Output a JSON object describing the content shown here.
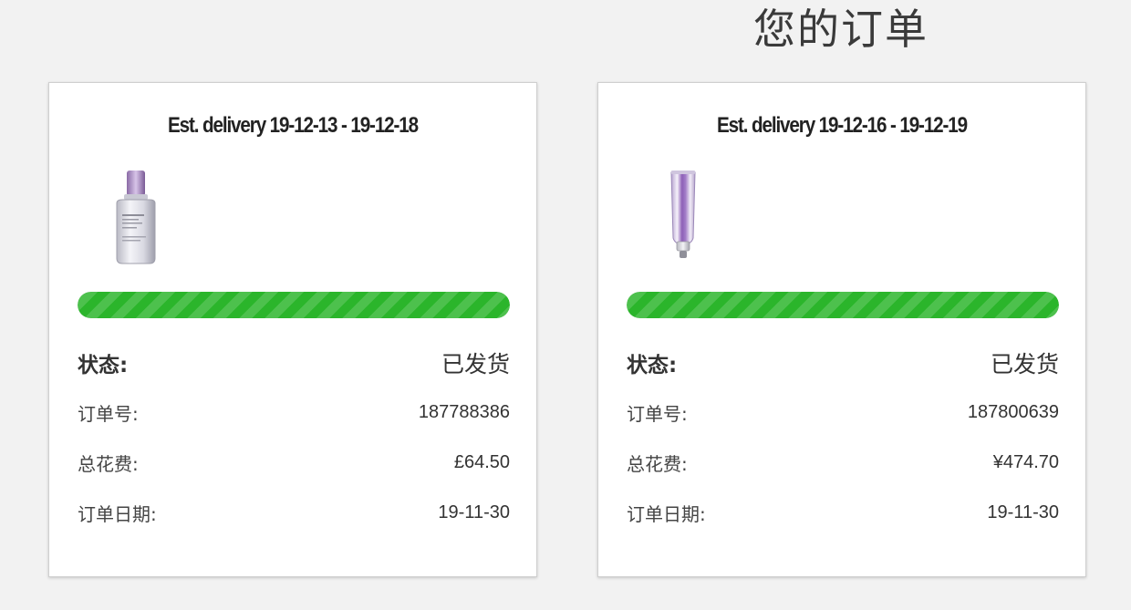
{
  "page": {
    "title": "您的订单"
  },
  "labels": {
    "status": "状态:",
    "order_number": "订单号:",
    "total_cost": "总花费:",
    "order_date": "订单日期:"
  },
  "orders": [
    {
      "delivery": "Est. delivery 19-12-13 - 19-12-18",
      "product_icon": "serum-bottle-icon",
      "progress_percent": 100,
      "status": "已发货",
      "order_number": "187788386",
      "total": "£64.50",
      "date": "19-11-30"
    },
    {
      "delivery": "Est. delivery 19-12-16 - 19-12-19",
      "product_icon": "cream-tube-icon",
      "progress_percent": 100,
      "status": "已发货",
      "order_number": "187800639",
      "total": "¥474.70",
      "date": "19-11-30"
    }
  ],
  "colors": {
    "background": "#f2f2f2",
    "card": "#ffffff",
    "progress": "#2bb52b",
    "text": "#333333"
  }
}
